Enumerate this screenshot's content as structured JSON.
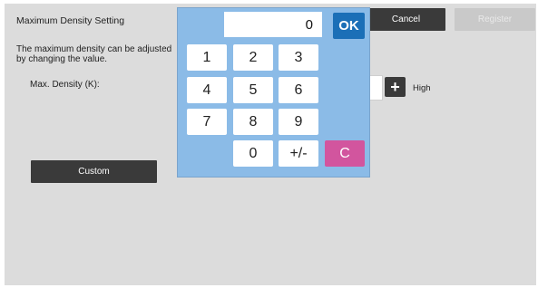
{
  "header": {
    "title": "Maximum Density Setting",
    "cancel_label": "Cancel",
    "register_label": "Register"
  },
  "description": "The maximum density can be adjusted by changing the value.",
  "field_label": "Max. Density (K):",
  "slider": {
    "high_label": "High",
    "plus_label": "+",
    "paren_fragment": ")"
  },
  "custom_label": "Custom",
  "keypad": {
    "display_value": "0",
    "ok_label": "OK",
    "keys": {
      "k1": "1",
      "k2": "2",
      "k3": "3",
      "k4": "4",
      "k5": "5",
      "k6": "6",
      "k7": "7",
      "k8": "8",
      "k9": "9",
      "k0": "0",
      "sign": "+/-",
      "clear": "C"
    }
  },
  "colors": {
    "keypad_bg": "#8bbbe7",
    "ok_bg": "#1b6fb7",
    "clear_bg": "#d2559e",
    "dark_button": "#3a3a3a"
  }
}
